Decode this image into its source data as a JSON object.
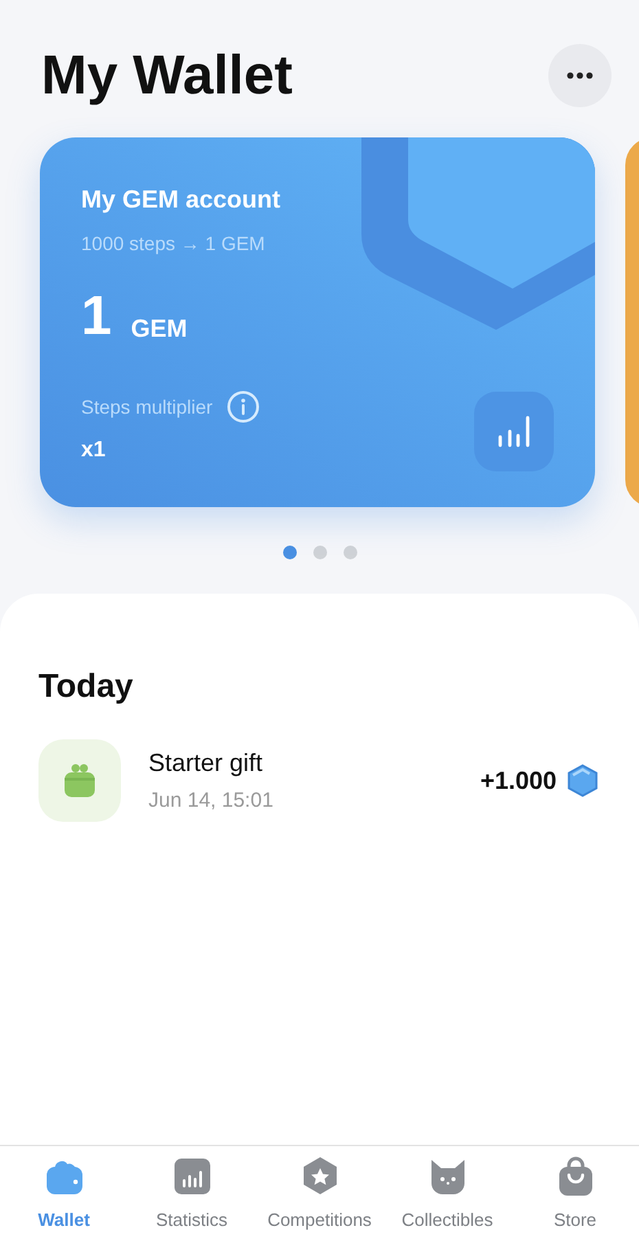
{
  "header": {
    "title": "My Wallet"
  },
  "cards": [
    {
      "title": "My GEM account",
      "rate": "1000 steps → 1 GEM",
      "amount": "1",
      "unit": "GEM",
      "multiplier_label": "Steps multiplier",
      "multiplier": "x1"
    }
  ],
  "pager": [
    {
      "selected": true
    },
    {
      "selected": false
    },
    {
      "selected": false
    }
  ],
  "activity": {
    "heading": "Today",
    "items": [
      {
        "title": "Starter gift",
        "time": "Jun 14, 15:01",
        "amount": "+1.000"
      }
    ]
  },
  "tabs": [
    {
      "kind": "wallet",
      "label": "Wallet",
      "selected": true
    },
    {
      "kind": "statistics",
      "label": "Statistics",
      "selected": false
    },
    {
      "kind": "competitions",
      "label": "Competitions",
      "selected": false
    },
    {
      "kind": "collectibles",
      "label": "Collectibles",
      "selected": false
    },
    {
      "kind": "store",
      "label": "Store",
      "selected": false
    }
  ]
}
